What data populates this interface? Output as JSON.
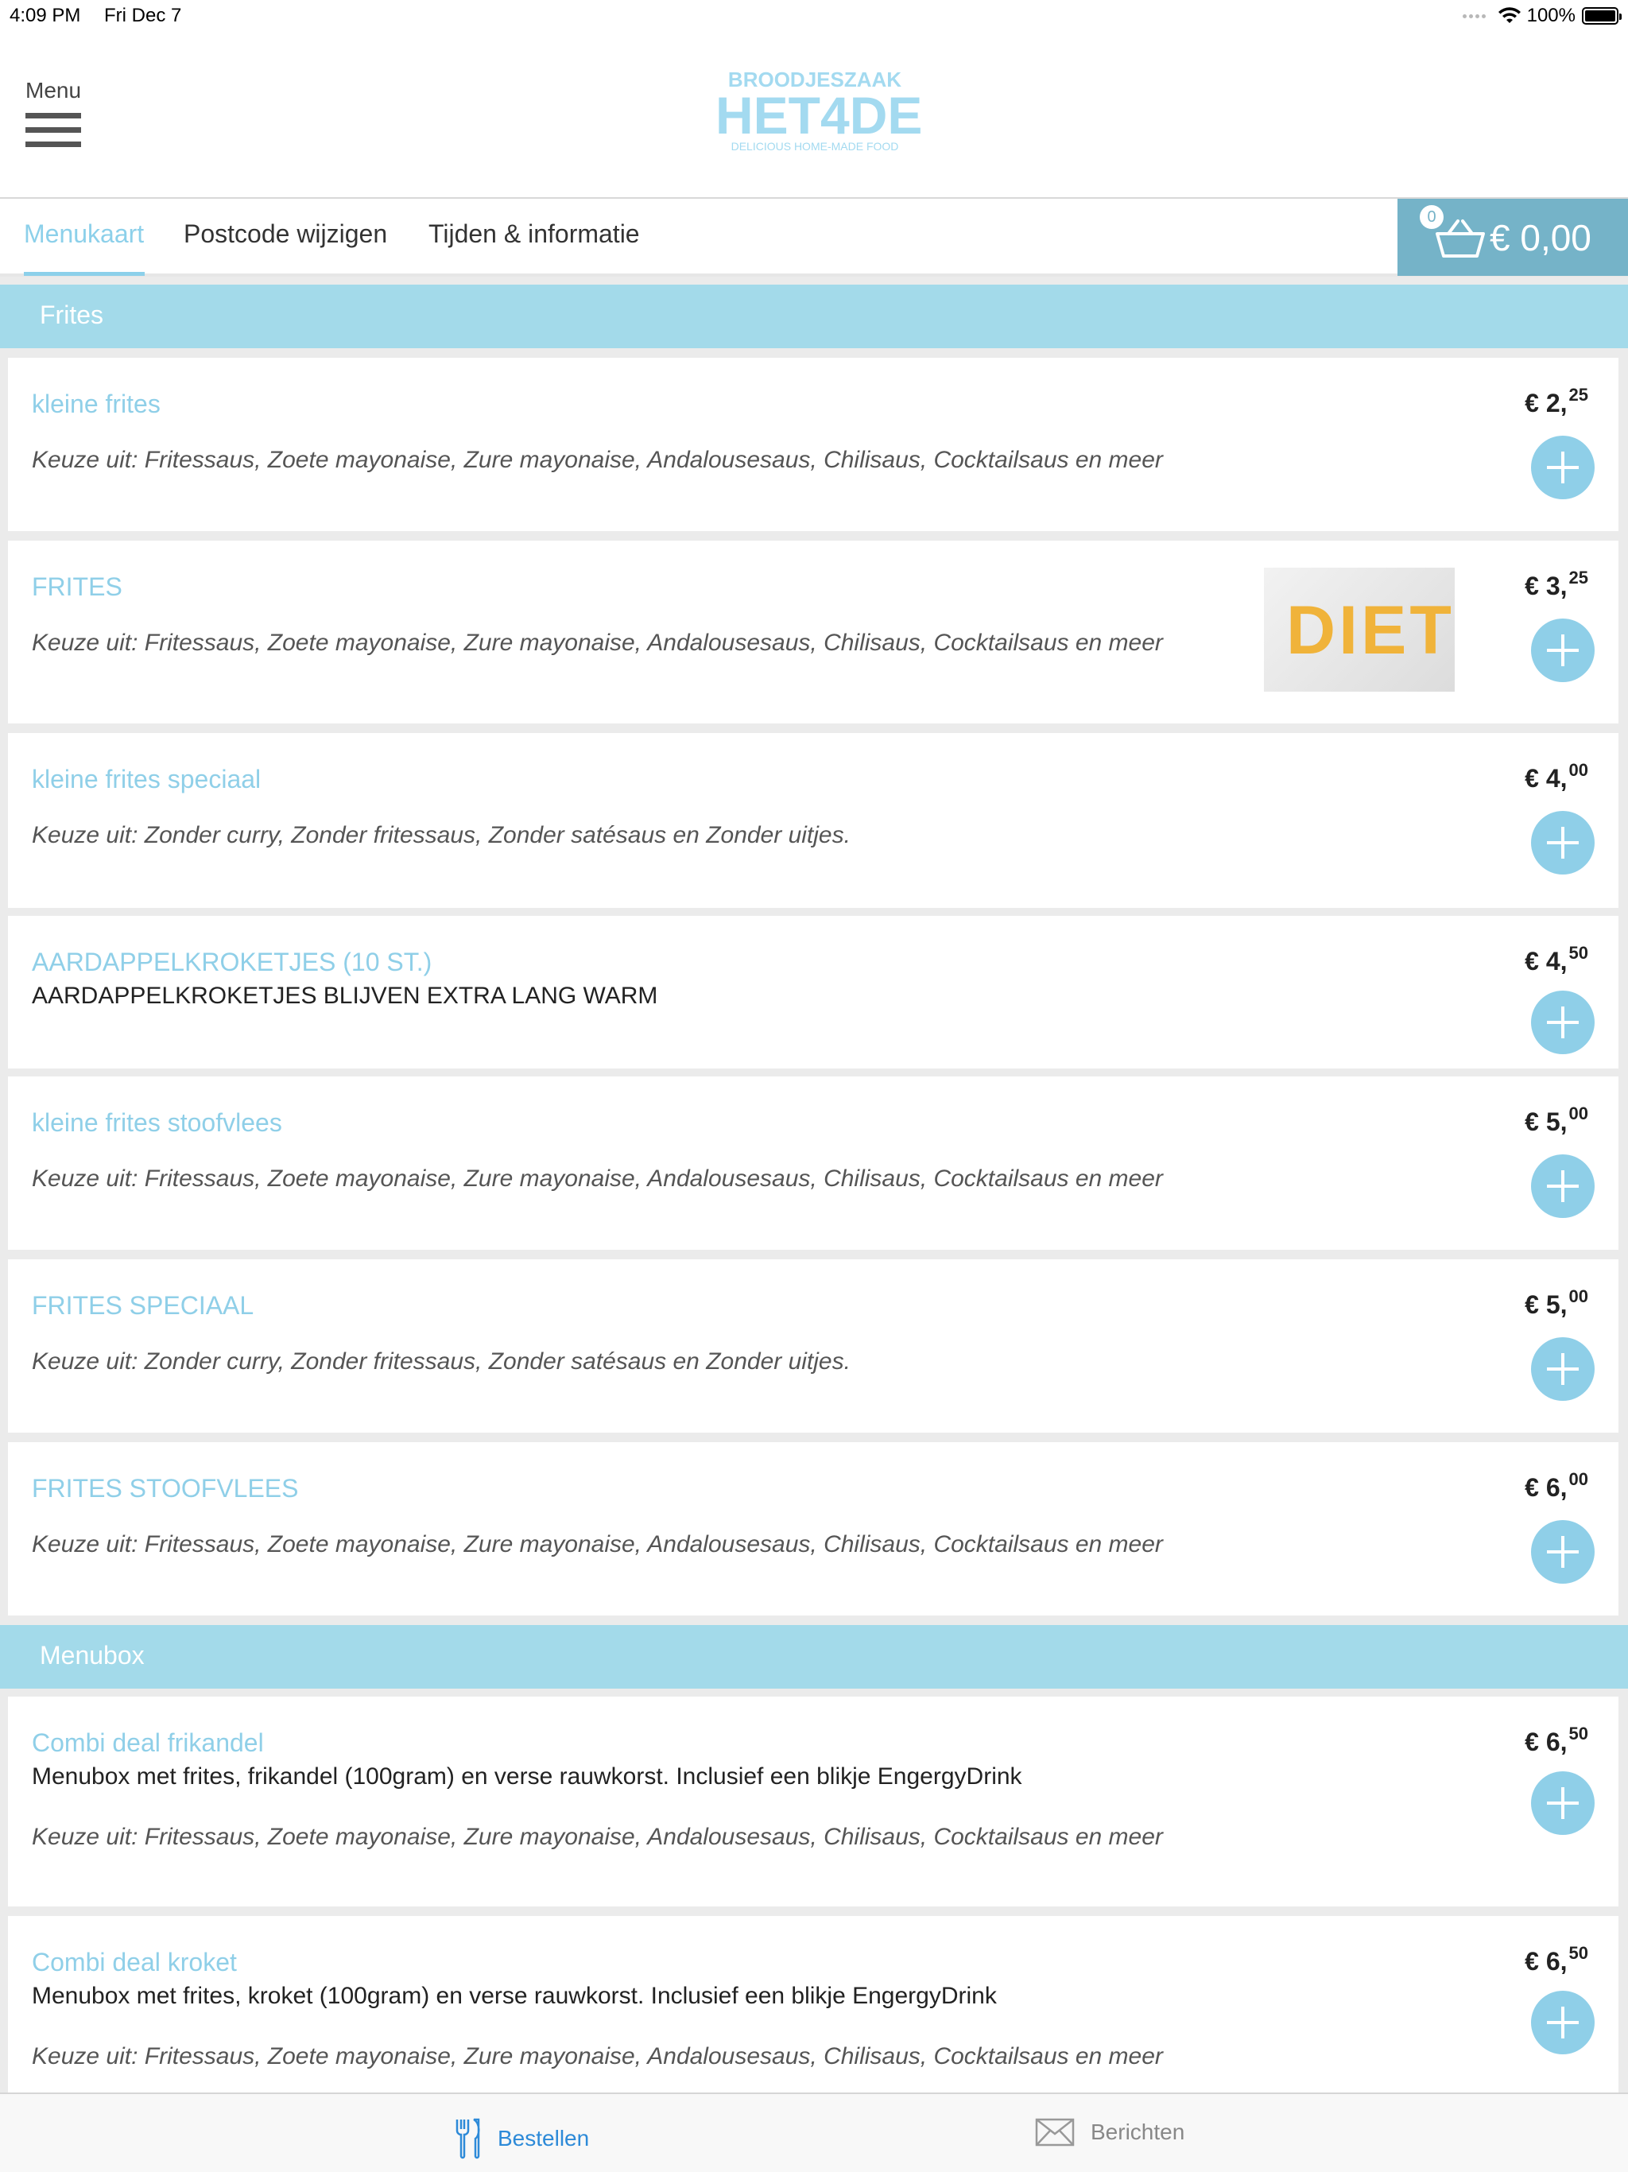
{
  "status_bar": {
    "time": "4:09 PM",
    "date": "Fri Dec 7",
    "battery": "100%"
  },
  "header": {
    "menu_label": "Menu",
    "logo": {
      "top": "BROODJESZAAK",
      "main": "HET4DE",
      "sub": "DELICIOUS HOME-MADE FOOD"
    }
  },
  "tabs": [
    {
      "label": "Menukaart",
      "active": true
    },
    {
      "label": "Postcode wijzigen"
    },
    {
      "label": "Tijden & informatie"
    }
  ],
  "cart": {
    "count": "0",
    "total": "€ 0,00"
  },
  "sections": [
    {
      "title": "Frites",
      "items": [
        {
          "name": "kleine frites",
          "price_main": "€ 2,",
          "price_cents": "25",
          "options": "Keuze uit: Fritessaus, Zoete mayonaise, Zure mayonaise, Andalousesaus, Chilisaus, Cocktailsaus en meer"
        },
        {
          "name": "FRITES",
          "price_main": "€ 3,",
          "price_cents": "25",
          "options": "Keuze uit: Fritessaus, Zoete mayonaise, Zure mayonaise, Andalousesaus, Chilisaus, Cocktailsaus en meer",
          "image_text": "DIET"
        },
        {
          "name": "kleine frites speciaal",
          "price_main": "€ 4,",
          "price_cents": "00",
          "options": "Keuze uit: Zonder curry, Zonder fritessaus, Zonder satésaus en Zonder uitjes."
        },
        {
          "name": "AARDAPPELKROKETJES (10 ST.)",
          "price_main": "€ 4,",
          "price_cents": "50",
          "description": "AARDAPPELKROKETJES BLIJVEN EXTRA LANG WARM"
        },
        {
          "name": "kleine frites stoofvlees",
          "price_main": "€ 5,",
          "price_cents": "00",
          "options": "Keuze uit: Fritessaus, Zoete mayonaise, Zure mayonaise, Andalousesaus, Chilisaus, Cocktailsaus en meer"
        },
        {
          "name": "FRITES SPECIAAL",
          "price_main": "€ 5,",
          "price_cents": "00",
          "options": "Keuze uit: Zonder curry, Zonder fritessaus, Zonder satésaus en Zonder uitjes."
        },
        {
          "name": "FRITES STOOFVLEES",
          "price_main": "€ 6,",
          "price_cents": "00",
          "options": "Keuze uit: Fritessaus, Zoete mayonaise, Zure mayonaise, Andalousesaus, Chilisaus, Cocktailsaus en meer"
        }
      ]
    },
    {
      "title": "Menubox",
      "items": [
        {
          "name": "Combi deal frikandel",
          "price_main": "€ 6,",
          "price_cents": "50",
          "description": "Menubox met frites, frikandel (100gram) en verse rauwkorst. Inclusief een blikje EngergyDrink",
          "options": "Keuze uit: Fritessaus, Zoete mayonaise, Zure mayonaise, Andalousesaus, Chilisaus, Cocktailsaus en meer"
        },
        {
          "name": "Combi deal kroket",
          "price_main": "€ 6,",
          "price_cents": "50",
          "description": "Menubox met frites, kroket (100gram) en verse rauwkorst. Inclusief een blikje EngergyDrink",
          "options": "Keuze uit: Fritessaus, Zoete mayonaise, Zure mayonaise, Andalousesaus, Chilisaus, Cocktailsaus en meer"
        }
      ]
    }
  ],
  "bottom_tabs": [
    {
      "label": "Bestellen",
      "icon": "fork-knife-icon",
      "active": true
    },
    {
      "label": "Berichten",
      "icon": "envelope-icon"
    }
  ],
  "colors": {
    "accent": "#8fcfe8",
    "section_bg": "#a3daea",
    "cart_bg": "#75b3c8",
    "active_bottom_tab": "#2d8ad8"
  }
}
